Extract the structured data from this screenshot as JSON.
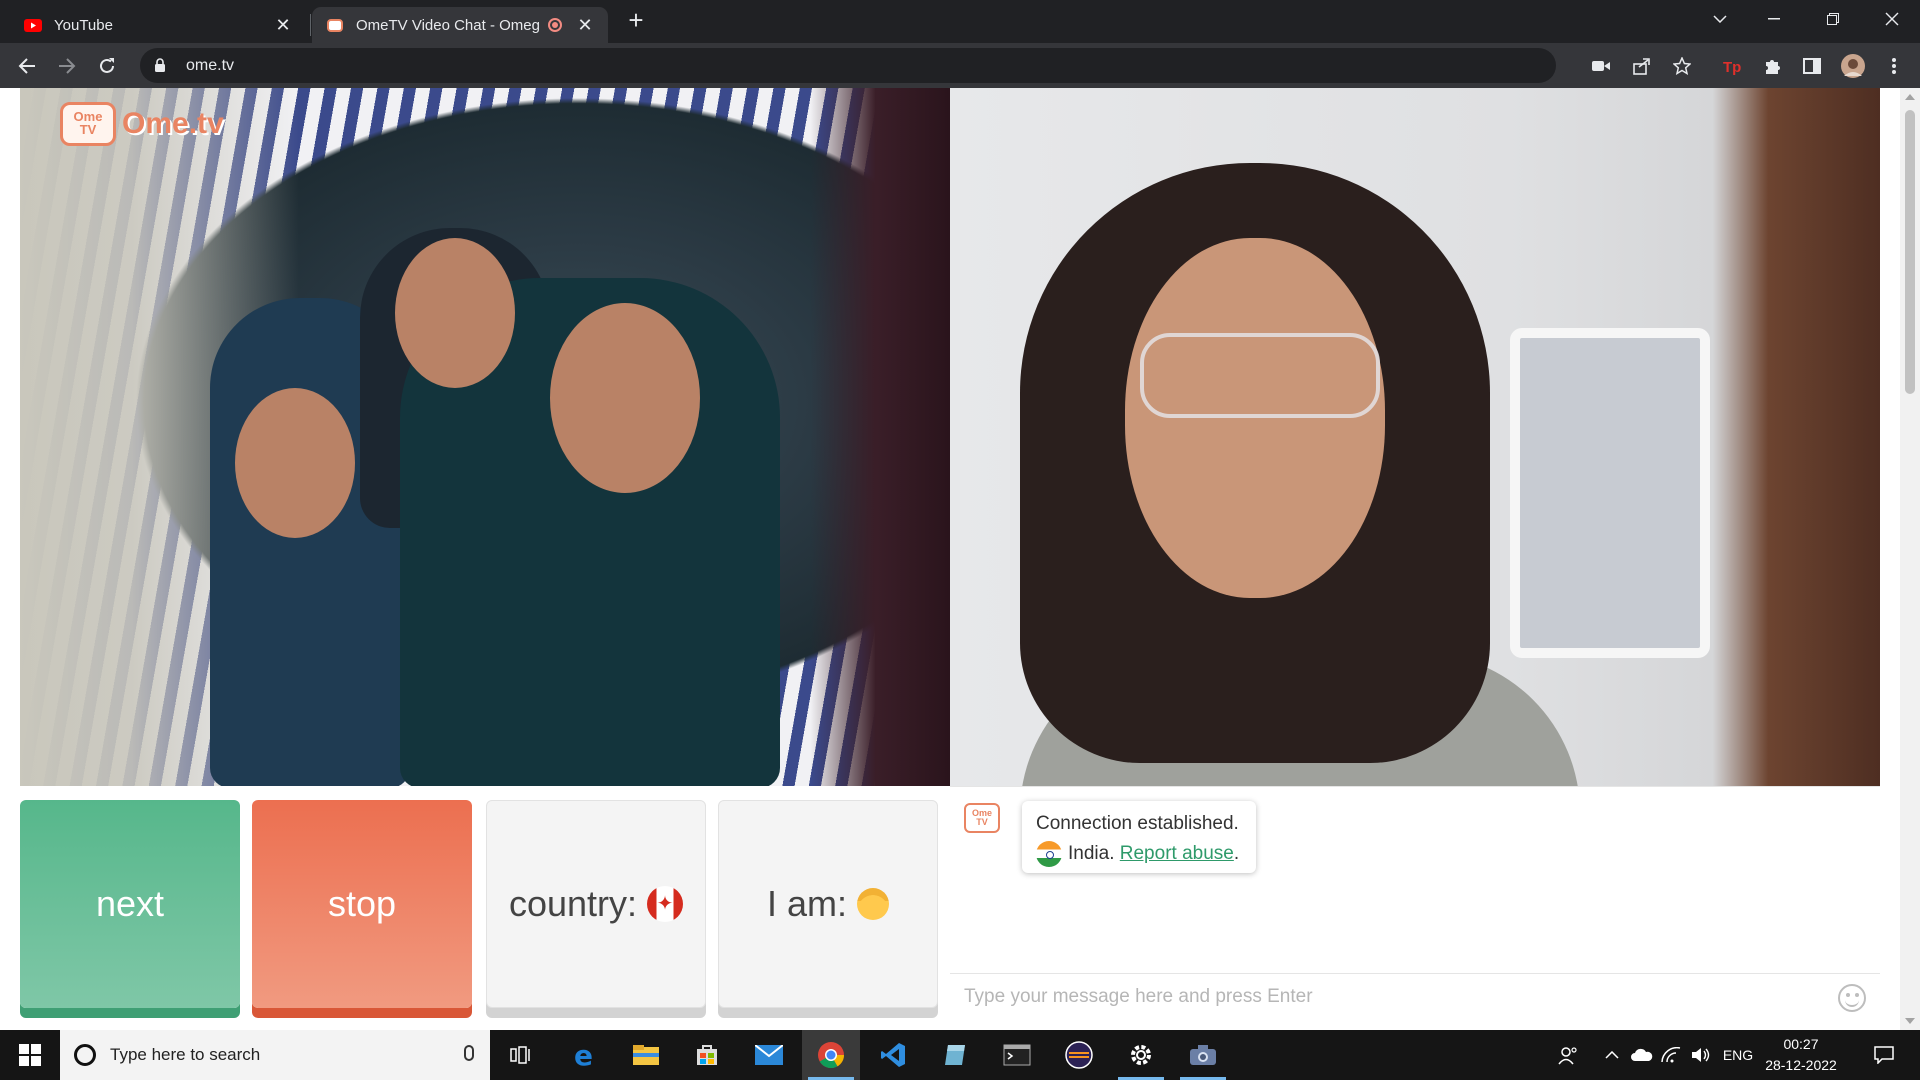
{
  "browser": {
    "tabs": [
      {
        "title": "YouTube",
        "favicon": "youtube-icon"
      },
      {
        "title": "OmeTV Video Chat - Omegle",
        "favicon": "ometv-icon",
        "recording": true
      }
    ],
    "url": "ome.tv",
    "new_tab": "+",
    "close_glyph": "✕"
  },
  "page": {
    "logo_badge_line1": "Ome",
    "logo_badge_line2": "TV",
    "logo_text": "Ome.tv",
    "buttons": {
      "next": "next",
      "stop": "stop",
      "country_label": "country:",
      "iam_label": "I am:"
    },
    "chat": {
      "line1": "Connection established.",
      "country": "India.",
      "report_link": "Report abuse",
      "report_suffix": ".",
      "input_placeholder": "Type your message here and press Enter"
    }
  },
  "taskbar": {
    "search_placeholder": "Type here to search",
    "language": "ENG",
    "time": "00:27",
    "date": "28-12-2022"
  },
  "colors": {
    "next": "#56b78b",
    "stop": "#ec6f50",
    "brand": "#e98462",
    "link": "#2e9a6a"
  }
}
